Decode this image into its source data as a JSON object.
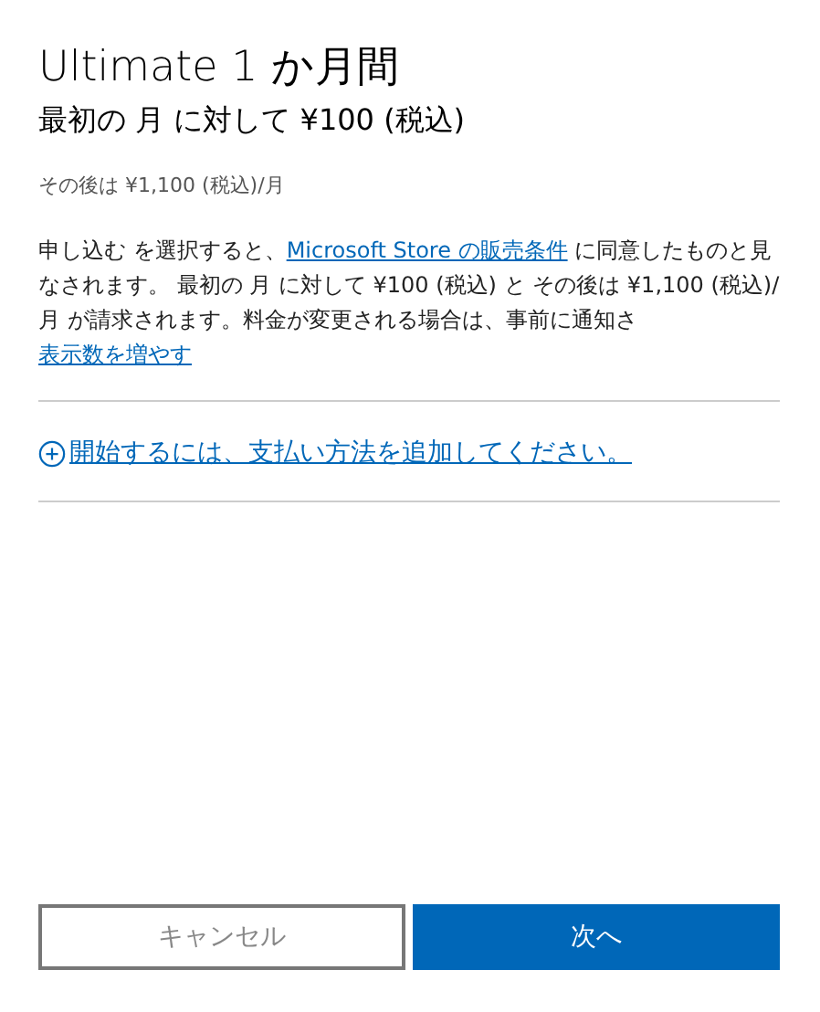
{
  "title": "Ultimate 1 か月間",
  "subtitle": "最初の 月 に対して ¥100 (税込)",
  "after_price": "その後は ¥1,100 (税込)/月",
  "terms": {
    "before": "申し込む を選択すると、",
    "link": "Microsoft Store の販売条件",
    "after": " に同意したものと見なされます。 最初の 月 に対して ¥100 (税込) と その後は ¥1,100 (税込)/月 が請求されます。料金が変更される場合は、事前に通知さ"
  },
  "show_more": "表示数を増やす",
  "add_payment": "開始するには、支払い方法を追加してください。",
  "buttons": [
    {
      "label": "キャンセル",
      "kind": "secondary"
    },
    {
      "label": "次へ",
      "kind": "primary"
    }
  ]
}
